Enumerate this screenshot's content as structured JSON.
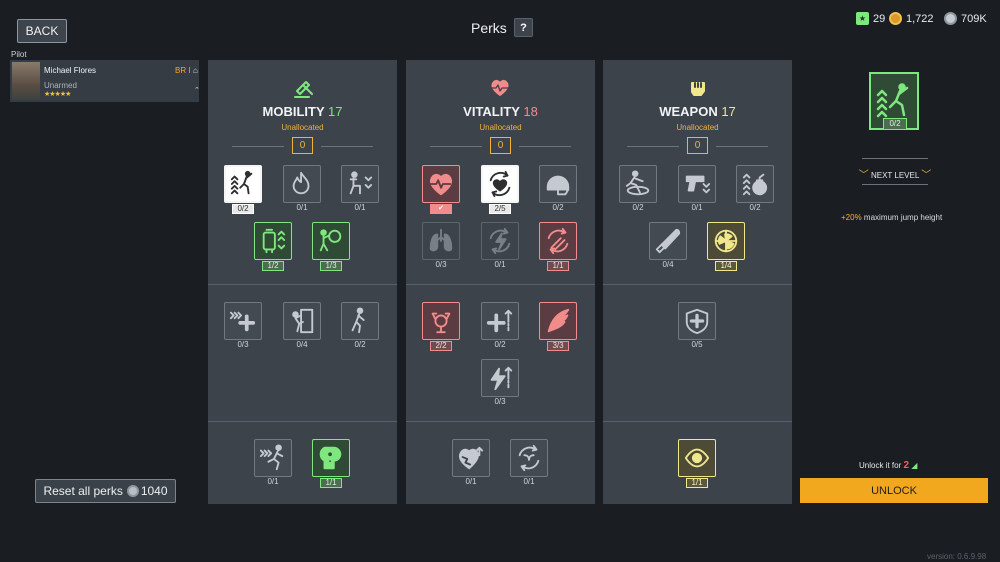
{
  "header": {
    "back_label": "BACK",
    "title": "Perks",
    "help_label": "?"
  },
  "currencies": {
    "tickets": "29",
    "gold": "1,722",
    "silver": "709K"
  },
  "pilot": {
    "section_label": "Pilot",
    "name": "Michael Flores",
    "weapon": "Unarmed",
    "stars": "★★★★★",
    "rank": "BR I"
  },
  "reset": {
    "label": "Reset all perks",
    "cost": "1040"
  },
  "columns": [
    {
      "name": "MOBILITY",
      "points": "17",
      "sub": "Unallocated",
      "alloc": "0",
      "perks": [
        {
          "name": "jump-boost",
          "count": "0/2",
          "style": "white"
        },
        {
          "name": "fire-resist",
          "count": "0/1",
          "style": "mono"
        },
        {
          "name": "crouch-speed",
          "count": "0/1",
          "style": "mono"
        },
        {
          "name": "jetpack-fuel",
          "count": "1/2",
          "style": "green"
        },
        {
          "name": "grenade-throw",
          "count": "1/3",
          "style": "green"
        },
        {
          "name": "sprint-heal",
          "count": "0/3",
          "style": "mono"
        },
        {
          "name": "climb",
          "count": "0/4",
          "style": "mono"
        },
        {
          "name": "walk-speed",
          "count": "0/2",
          "style": "mono"
        },
        {
          "name": "sprint-speed",
          "count": "0/1",
          "style": "mono"
        },
        {
          "name": "radiation-resist",
          "count": "1/1",
          "style": "green"
        }
      ]
    },
    {
      "name": "VITALITY",
      "points": "18",
      "sub": "Unallocated",
      "alloc": "0",
      "perks": [
        {
          "name": "heart-rate",
          "count": "✔",
          "style": "redcheck"
        },
        {
          "name": "cardio-recovery",
          "count": "2/5",
          "style": "white"
        },
        {
          "name": "helmet-armor",
          "count": "0/2",
          "style": "mono"
        },
        {
          "name": "lungs",
          "count": "0/3",
          "style": "dim"
        },
        {
          "name": "energy-recovery",
          "count": "0/1",
          "style": "dim"
        },
        {
          "name": "stamina-recovery",
          "count": "1/1",
          "style": "red"
        },
        {
          "name": "muscle-strength",
          "count": "2/2",
          "style": "red"
        },
        {
          "name": "health-boost",
          "count": "0/2",
          "style": "mono"
        },
        {
          "name": "wing-speed",
          "count": "3/3",
          "style": "red"
        },
        {
          "name": "energy-boost",
          "count": "0/3",
          "style": "mono"
        },
        {
          "name": "heal-rate",
          "count": "0/1",
          "style": "mono"
        },
        {
          "name": "regeneration",
          "count": "0/1",
          "style": "mono"
        }
      ]
    },
    {
      "name": "WEAPON",
      "points": "17",
      "sub": "Unallocated",
      "alloc": "0",
      "perks": [
        {
          "name": "slide",
          "count": "0/2",
          "style": "mono"
        },
        {
          "name": "pistol-handling",
          "count": "0/1",
          "style": "mono"
        },
        {
          "name": "grenade-capacity",
          "count": "0/2",
          "style": "mono"
        },
        {
          "name": "knife",
          "count": "0/4",
          "style": "mono"
        },
        {
          "name": "nuke-detection",
          "count": "1/4",
          "style": "yellow"
        },
        {
          "name": "medkit-armor",
          "count": "0/5",
          "style": "mono"
        },
        {
          "name": "eagle-eye",
          "count": "1/1",
          "style": "yellow"
        }
      ]
    }
  ],
  "detail": {
    "count": "0/2",
    "next_level": "NEXT LEVEL",
    "desc_highlight": "+20%",
    "desc_rest": "maximum jump height",
    "unlock_text": "Unlock it for",
    "unlock_cost": "2",
    "unlock_button": "UNLOCK"
  },
  "version": "version: 0.6.9.98"
}
